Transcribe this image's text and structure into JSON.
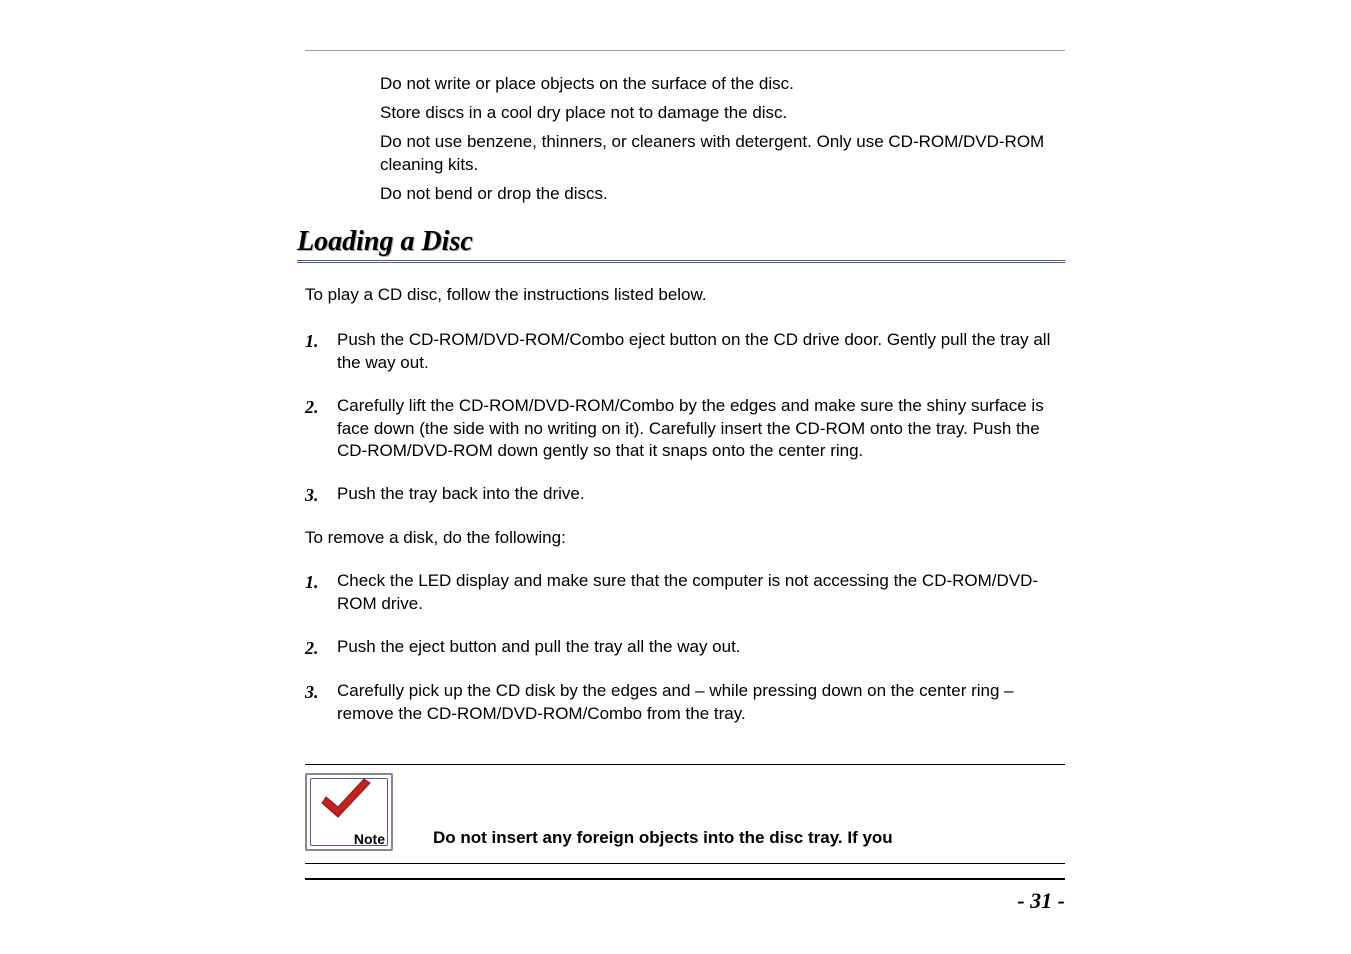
{
  "care": {
    "items": [
      "Do not write or place objects on the surface of the disc.",
      "Store discs in a cool dry place not to damage the disc.",
      "Do not use benzene, thinners, or cleaners with detergent.  Only use CD-ROM/DVD-ROM cleaning kits.",
      "Do not bend or drop the discs."
    ]
  },
  "heading": "Loading a Disc",
  "intro": "To play a CD disc, follow the instructions listed below.",
  "load_steps": [
    {
      "num": "1.",
      "text": "Push the CD-ROM/DVD-ROM/Combo eject button on the CD drive door.  Gently pull the tray all the way out."
    },
    {
      "num": "2.",
      "text": "Carefully lift the CD-ROM/DVD-ROM/Combo by the edges and make sure the shiny surface is face down (the side with no writing on it).  Carefully insert the CD-ROM onto the tray.  Push the CD-ROM/DVD-ROM down gently so that it snaps onto the center ring."
    },
    {
      "num": "3.",
      "text": "Push the tray back into the drive."
    }
  ],
  "remove_intro": "To remove a disk, do the following:",
  "remove_steps": [
    {
      "num": "1.",
      "text": "Check the LED display and make sure that the computer is not accessing the CD-ROM/DVD-ROM drive."
    },
    {
      "num": "2.",
      "text": "Push the eject button and pull the tray all the way out."
    },
    {
      "num": "3.",
      "text": "Carefully pick up the CD disk by the edges and – while pressing down on the center ring – remove the CD-ROM/DVD-ROM/Combo from the tray."
    }
  ],
  "note": {
    "label": "Note",
    "text": "Do not insert any foreign objects into the disc tray.  If you"
  },
  "page_number": "- 31 -"
}
